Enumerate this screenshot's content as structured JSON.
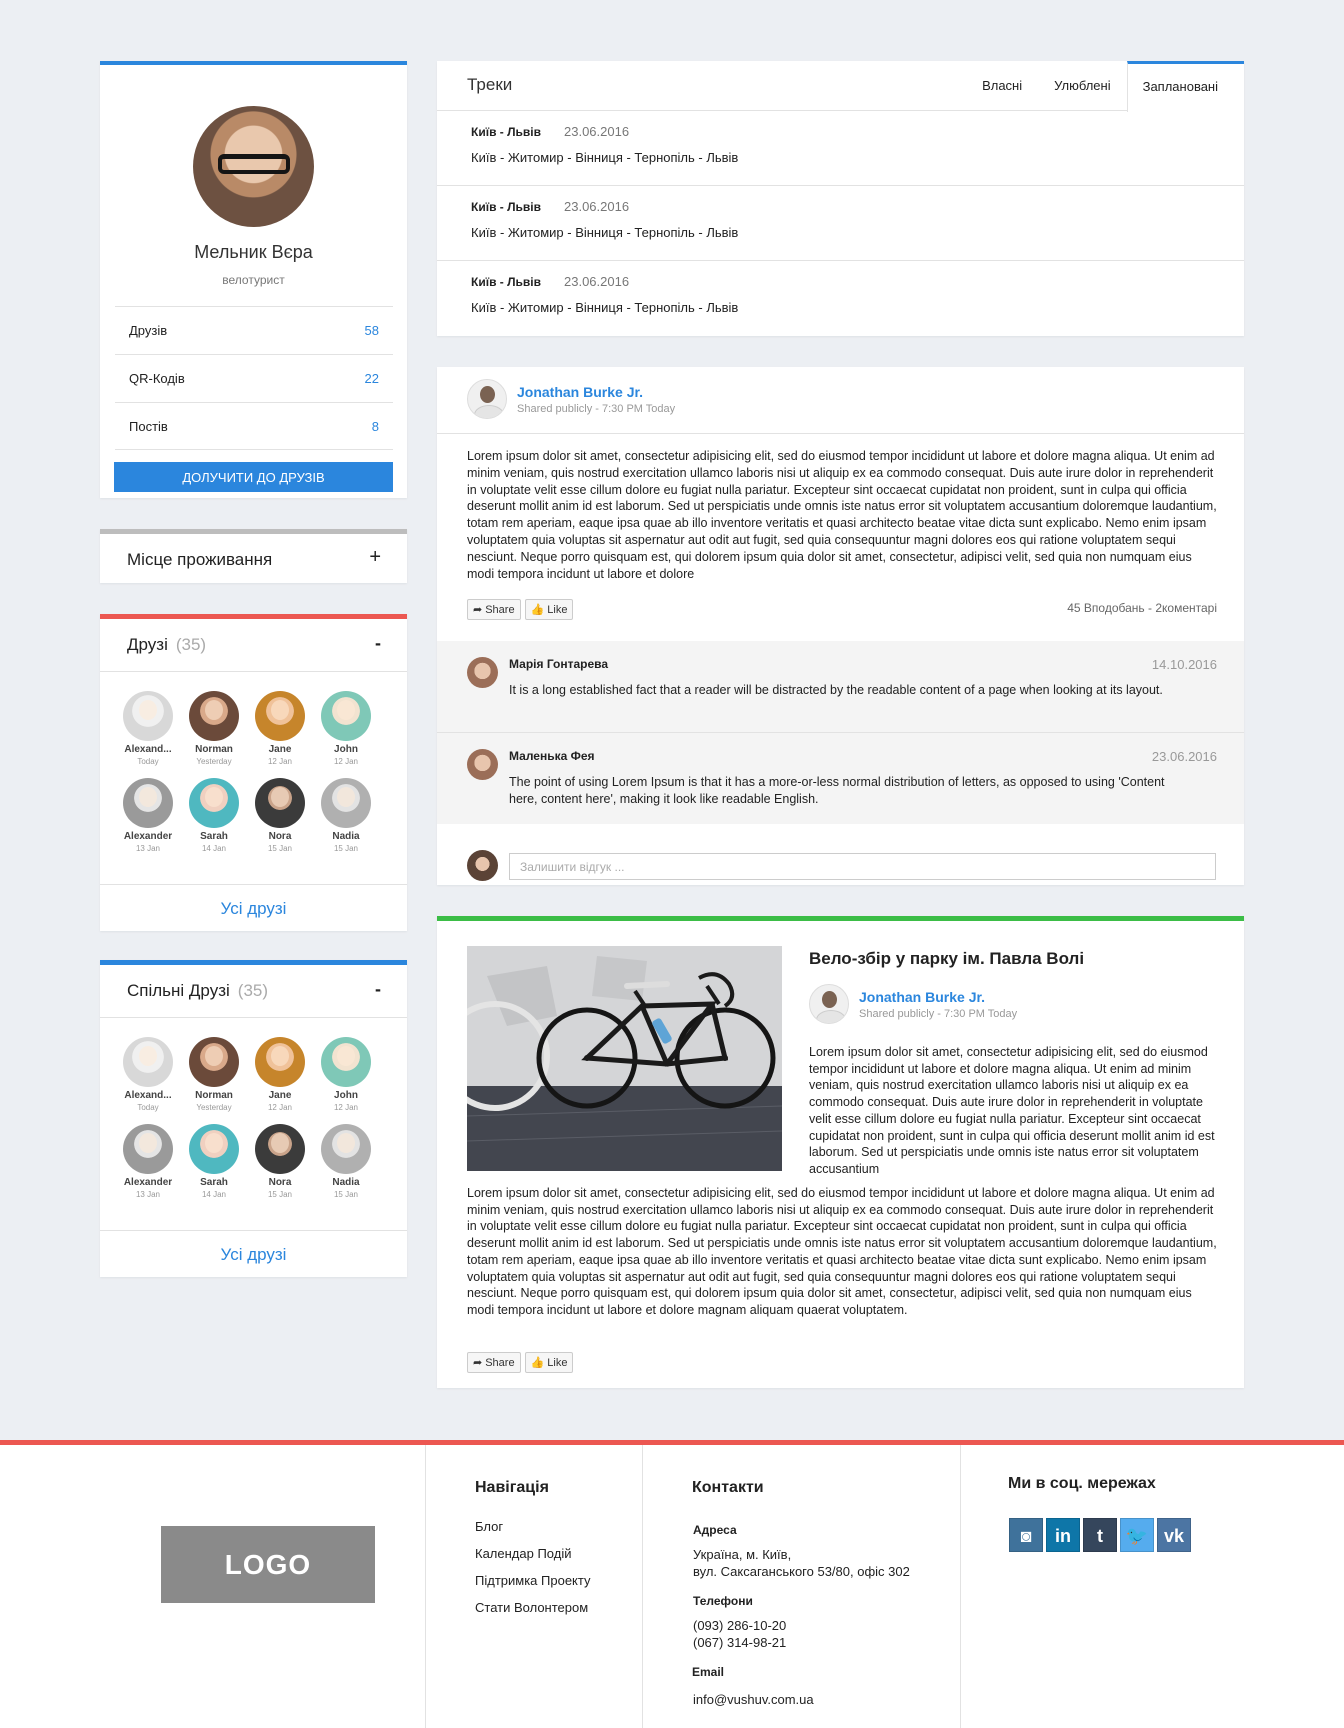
{
  "colors": {
    "accent": "#2b86dd",
    "red": "#ec5751",
    "green": "#3bbd46",
    "gray": "#bdbdbd"
  },
  "profile": {
    "name": "Мельник Вєра",
    "role": "велотурист",
    "stats": [
      {
        "label": "Друзів",
        "value": "58"
      },
      {
        "label": "QR-Кодів",
        "value": "22"
      },
      {
        "label": "Постів",
        "value": "8"
      }
    ],
    "add_button": "ДОЛУЧИТИ ДО ДРУЗІВ"
  },
  "location": {
    "title": "Місце проживання",
    "toggle": "+"
  },
  "friends": {
    "title": "Друзі",
    "count": "(35)",
    "toggle": "-",
    "all_link": "Усі друзі",
    "items": [
      {
        "name": "Alexand...",
        "date": "Today"
      },
      {
        "name": "Norman",
        "date": "Yesterday"
      },
      {
        "name": "Jane",
        "date": "12 Jan"
      },
      {
        "name": "John",
        "date": "12 Jan"
      },
      {
        "name": "Alexander",
        "date": "13 Jan"
      },
      {
        "name": "Sarah",
        "date": "14 Jan"
      },
      {
        "name": "Nora",
        "date": "15 Jan"
      },
      {
        "name": "Nadia",
        "date": "15 Jan"
      }
    ]
  },
  "common_friends": {
    "title": "Спільні Друзі",
    "count": "(35)",
    "toggle": "-",
    "all_link": "Усі друзі",
    "items": [
      {
        "name": "Alexand...",
        "date": "Today"
      },
      {
        "name": "Norman",
        "date": "Yesterday"
      },
      {
        "name": "Jane",
        "date": "12 Jan"
      },
      {
        "name": "John",
        "date": "12 Jan"
      },
      {
        "name": "Alexander",
        "date": "13 Jan"
      },
      {
        "name": "Sarah",
        "date": "14 Jan"
      },
      {
        "name": "Nora",
        "date": "15 Jan"
      },
      {
        "name": "Nadia",
        "date": "15 Jan"
      }
    ]
  },
  "tracks": {
    "title": "Треки",
    "tabs": [
      "Власні",
      "Улюблені",
      "Заплановані"
    ],
    "active_tab": "Заплановані",
    "items": [
      {
        "route": "Київ - Львів",
        "date": "23.06.2016",
        "stops": "Київ - Житомир - Вінниця - Тернопіль - Львів"
      },
      {
        "route": "Київ - Львів",
        "date": "23.06.2016",
        "stops": "Київ - Житомир - Вінниця - Тернопіль - Львів"
      },
      {
        "route": "Київ - Львів",
        "date": "23.06.2016",
        "stops": "Київ - Житомир - Вінниця - Тернопіль - Львів"
      }
    ]
  },
  "post1": {
    "author": "Jonathan Burke Jr.",
    "shared": "Shared publicly - 7:30 PM Today",
    "body": "Lorem ipsum dolor sit amet, consectetur adipisicing elit, sed do eiusmod tempor incididunt ut labore et dolore magna aliqua. Ut enim ad minim veniam, quis nostrud exercitation ullamco laboris nisi ut aliquip ex ea commodo consequat. Duis aute irure dolor in reprehenderit in voluptate velit esse cillum dolore eu fugiat nulla pariatur. Excepteur sint occaecat cupidatat non proident, sunt in culpa qui officia deserunt mollit anim id est laborum. Sed ut perspiciatis unde omnis iste natus error sit voluptatem accusantium doloremque laudantium, totam rem aperiam, eaque ipsa quae ab illo inventore veritatis et quasi architecto beatae vitae dicta sunt explicabo. Nemo enim ipsam voluptatem quia voluptas sit aspernatur aut odit aut fugit, sed quia consequuntur magni dolores eos qui ratione voluptatem sequi nesciunt. Neque porro quisquam est, qui dolorem ipsum quia dolor sit amet, consectetur, adipisci velit, sed quia non numquam eius modi tempora incidunt ut labore et dolore",
    "share_label": "Share",
    "like_label": "Like",
    "counts": "45 Вподобань - 2коментарі",
    "comments": [
      {
        "name": "Марія Гонтарева",
        "date": "14.10.2016",
        "text": "It is a long established fact that a reader will be distracted by the readable content of a page when looking at its layout."
      },
      {
        "name": "Маленька Фея",
        "date": "23.06.2016",
        "text": "The point of using Lorem Ipsum is that it has a more-or-less normal distribution of letters, as opposed to using 'Content here, content here', making it look like readable English."
      }
    ],
    "reply_placeholder": "Залишити відгук ..."
  },
  "post2": {
    "title": "Вело-збір у парку ім. Павла Волі",
    "author": "Jonathan Burke Jr.",
    "shared": "Shared publicly - 7:30 PM Today",
    "side_text": "Lorem ipsum dolor sit amet, consectetur adipisicing elit, sed do eiusmod tempor incididunt ut labore et dolore magna aliqua. Ut enim ad minim veniam, quis nostrud exercitation ullamco laboris nisi ut aliquip ex ea commodo consequat. Duis aute irure dolor in reprehenderit in voluptate velit esse cillum dolore eu fugiat nulla pariatur. Excepteur sint occaecat cupidatat non proident, sunt in culpa qui officia deserunt mollit anim id est laborum. Sed ut perspiciatis unde omnis iste natus error sit voluptatem accusantium",
    "body": "Lorem ipsum dolor sit amet, consectetur adipisicing elit, sed do eiusmod tempor incididunt ut labore et dolore magna aliqua. Ut enim ad minim veniam, quis nostrud exercitation ullamco laboris nisi ut aliquip ex ea commodo consequat. Duis aute irure dolor in reprehenderit in voluptate velit esse cillum dolore eu fugiat nulla pariatur. Excepteur sint occaecat cupidatat non proident, sunt in culpa qui officia deserunt mollit anim id est laborum. Sed ut perspiciatis unde omnis iste natus error sit voluptatem accusantium doloremque laudantium, totam rem aperiam, eaque ipsa quae ab illo inventore veritatis et quasi architecto beatae vitae dicta sunt explicabo. Nemo enim ipsam voluptatem quia voluptas sit aspernatur aut odit aut fugit, sed quia consequuntur magni dolores eos qui ratione voluptatem sequi nesciunt. Neque porro quisquam est, qui dolorem ipsum quia dolor sit amet, consectetur, adipisci velit, sed quia non numquam eius modi tempora incidunt ut labore et dolore magnam aliquam quaerat voluptatem.",
    "share_label": "Share",
    "like_label": "Like"
  },
  "footer": {
    "logo": "LOGO",
    "nav_title": "Навігація",
    "nav_items": [
      "Блог",
      "Календар Подій",
      "Підтримка Проекту",
      "Стати Волонтером"
    ],
    "contacts_title": "Контакти",
    "address_label": "Адреса",
    "address_line1": "Україна, м. Київ,",
    "address_line2": "вул. Саксаганського 53/80, офіс 302",
    "phones_label": "Телефони",
    "phone1": "(093) 286-10-20",
    "phone2": "(067) 314-98-21",
    "email_label": "Email",
    "email": "info@vushuv.com.ua",
    "social_title": "Ми в соц. мережах",
    "social": [
      {
        "name": "instagram",
        "glyph": "◙",
        "color": "#3f729b"
      },
      {
        "name": "linkedin",
        "glyph": "in",
        "color": "#0e76a8"
      },
      {
        "name": "tumblr",
        "glyph": "t",
        "color": "#35465c"
      },
      {
        "name": "twitter",
        "glyph": "🐦",
        "color": "#55acee"
      },
      {
        "name": "vk",
        "glyph": "vk",
        "color": "#4c75a3"
      }
    ]
  }
}
